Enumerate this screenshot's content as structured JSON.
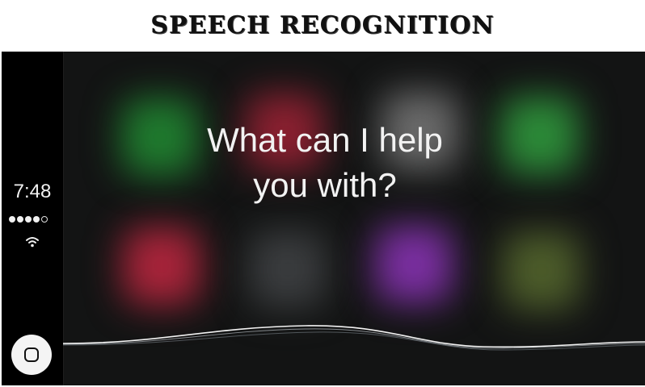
{
  "header": {
    "title": "SPEECH RECOGNITION"
  },
  "status": {
    "time": "7:48",
    "signal_bars": 4,
    "signal_max": 5
  },
  "siri": {
    "prompt_line1": "What can I help",
    "prompt_line2": "you with?"
  },
  "icons": {
    "home": "home-button-icon",
    "wifi": "wifi-icon",
    "signal": "signal-strength-icon"
  },
  "blurred_apps": [
    {
      "name": "phone-app",
      "color": "#1f7a2e"
    },
    {
      "name": "music-app",
      "color": "#8a2030"
    },
    {
      "name": "maps-app",
      "color": "#6a6a6a"
    },
    {
      "name": "messages-app",
      "color": "#2c8a38"
    },
    {
      "name": "podcasts-app",
      "color": "#a8243a"
    },
    {
      "name": "settings-app",
      "color": "#3a3c3e"
    },
    {
      "name": "audiobooks-app",
      "color": "#7a2fa0"
    },
    {
      "name": "app-8",
      "color": "#4c5c2a"
    }
  ]
}
